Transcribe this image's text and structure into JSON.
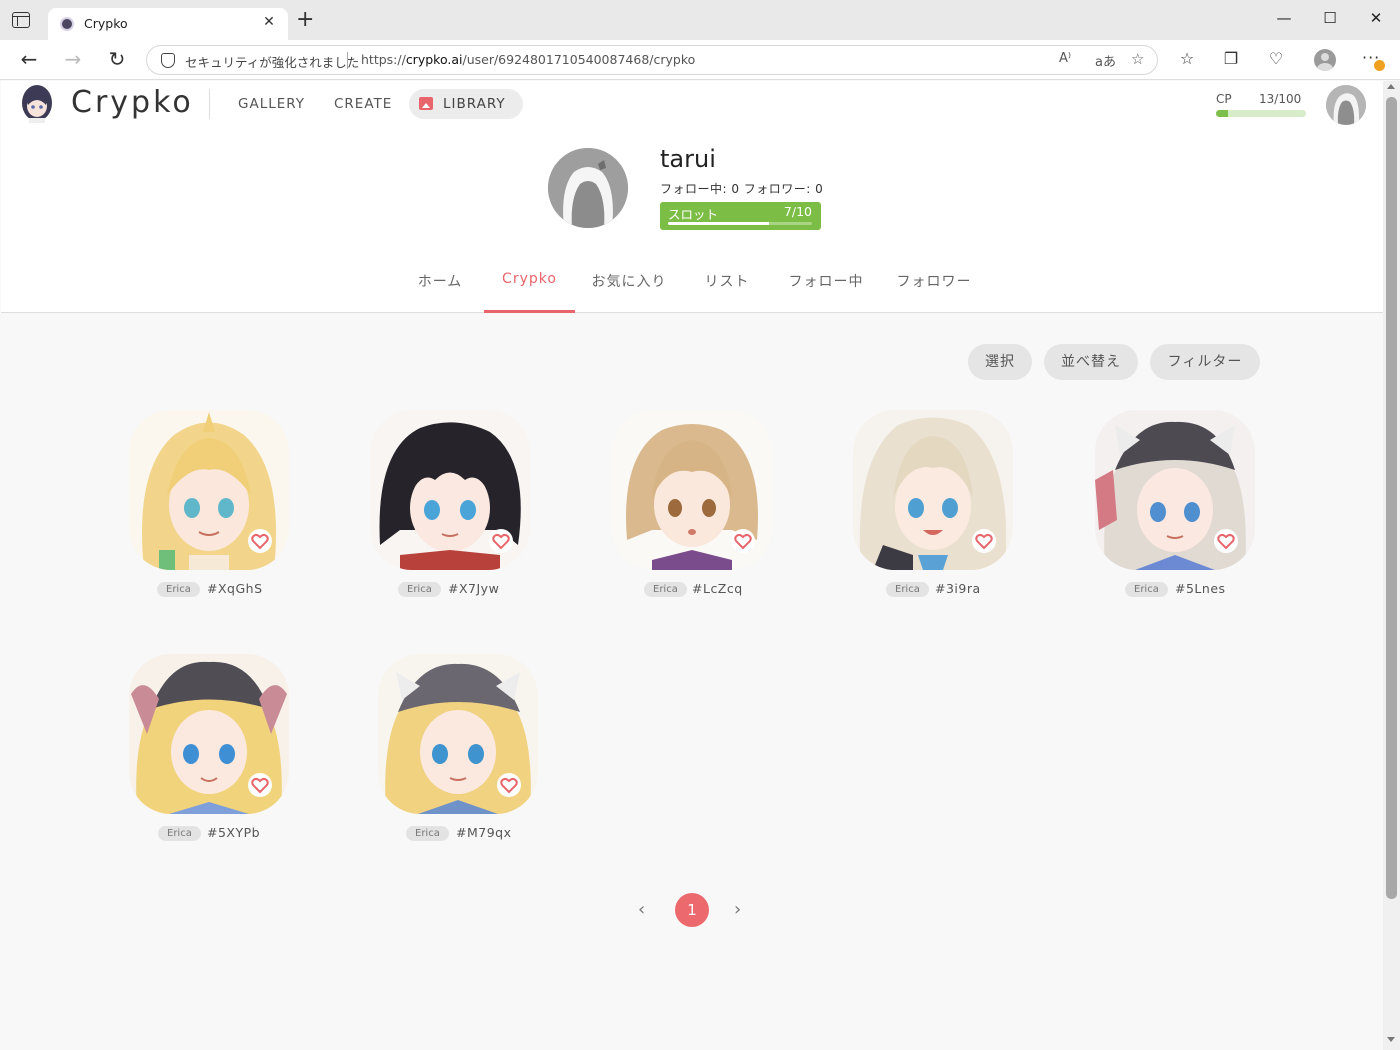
{
  "browser": {
    "tab_title": "Crypko",
    "tab_close": "✕",
    "new_tab": "+",
    "security_text": "セキュリティが強化されました",
    "url_prefix": "https://",
    "url_host": "crypko.ai",
    "url_path": "/user/6924801710540087468/crypko",
    "read_aloud": "A⁾",
    "translate": "aあ"
  },
  "site": {
    "logo": "Crypko",
    "nav": {
      "gallery": "GALLERY",
      "create": "CREATE",
      "library": "LIBRARY"
    },
    "cp": {
      "label": "CP",
      "value": "13/100",
      "fraction": 0.13
    }
  },
  "profile": {
    "username": "tarui",
    "follow_text": "フォロー中: 0  フォロワー: 0",
    "slot": {
      "label": "スロット",
      "value": "7/10",
      "fraction": 0.7
    }
  },
  "tabs": [
    "ホーム",
    "Crypko",
    "お気に入り",
    "リスト",
    "フォロー中",
    "フォロワー"
  ],
  "active_tab": "Crypko",
  "toolbar": {
    "select": "選択",
    "sort": "並べ替え",
    "filter": "フィルター"
  },
  "cards": [
    {
      "tag": "Erica",
      "id": "#XqGhS"
    },
    {
      "tag": "Erica",
      "id": "#X7Jyw"
    },
    {
      "tag": "Erica",
      "id": "#LcZcq"
    },
    {
      "tag": "Erica",
      "id": "#3i9ra"
    },
    {
      "tag": "Erica",
      "id": "#5Lnes"
    },
    {
      "tag": "Erica",
      "id": "#5XYPb"
    },
    {
      "tag": "Erica",
      "id": "#M79qx"
    }
  ],
  "pagination": {
    "current": "1",
    "prev": "‹",
    "next": "›"
  },
  "colors": {
    "accent": "#e8656b",
    "slot_green": "#7cbd45",
    "cp_green": "#7cc04b"
  }
}
